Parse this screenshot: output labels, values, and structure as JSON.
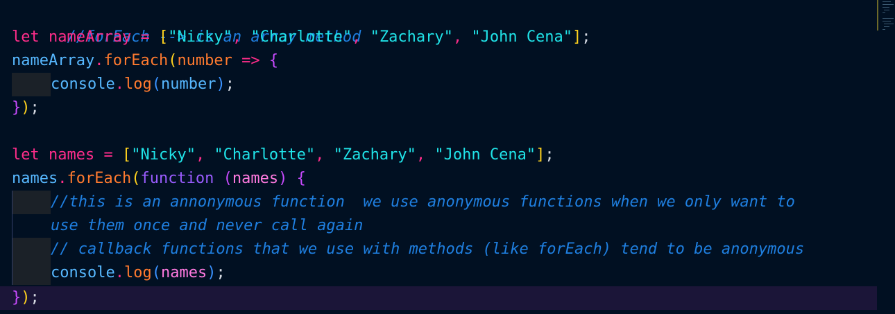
{
  "editor": {
    "lines": [
      {
        "text": "//forEach --> is an array method"
      },
      {
        "text": "let nameArray = [\"Nicky\", \"Charlotte\", \"Zachary\", \"John Cena\"];"
      },
      {
        "text": "nameArray.forEach(number => {"
      },
      {
        "text": "console.log(number);"
      },
      {
        "text": "});"
      },
      {
        "text": ""
      },
      {
        "text": "let names = [\"Nicky\", \"Charlotte\", \"Zachary\", \"John Cena\"];"
      },
      {
        "text": "names.forEach(function (names) {"
      },
      {
        "text": "//this is an annonymous function  we use anonymous functions when we only want to"
      },
      {
        "text": "use them once and never call again"
      },
      {
        "text": "// callback functions that we use with methods (like forEach) tend to be anonymous"
      },
      {
        "text": "console.log(names);"
      },
      {
        "text": "});"
      }
    ],
    "tokens": {
      "l1": {
        "t1": "//forEach --> is an array method"
      },
      "l2": {
        "t1": "let",
        "t2": " nameArray ",
        "t3": "=",
        "t4": " ",
        "t5": "[",
        "t6": "\"Nicky\"",
        "t7": ", ",
        "t8": "\"Charlotte\"",
        "t9": ", ",
        "t10": "\"Zachary\"",
        "t11": ", ",
        "t12": "\"John Cena\"",
        "t13": "]",
        "t14": ";"
      },
      "l3": {
        "t1": "nameArray",
        "t2": ".",
        "t3": "forEach",
        "t4": "(",
        "t5": "number",
        "t6": " ",
        "t7": "=>",
        "t8": " ",
        "t9": "{"
      },
      "l4": {
        "t1": "console",
        "t2": ".",
        "t3": "log",
        "t4": "(",
        "t5": "number",
        "t6": ")",
        "t7": ";"
      },
      "l5": {
        "t1": "}",
        "t2": ")",
        "t3": ";"
      },
      "l7": {
        "t1": "let",
        "t2": " names ",
        "t3": "=",
        "t4": " ",
        "t5": "[",
        "t6": "\"Nicky\"",
        "t7": ", ",
        "t8": "\"Charlotte\"",
        "t9": ", ",
        "t10": "\"Zachary\"",
        "t11": ", ",
        "t12": "\"John Cena\"",
        "t13": "]",
        "t14": ";"
      },
      "l8": {
        "t1": "names",
        "t2": ".",
        "t3": "forEach",
        "t4": "(",
        "t5": "function",
        "t6": " ",
        "t7": "(",
        "t8": "names",
        "t9": ")",
        "t10": " ",
        "t11": "{"
      },
      "l9": {
        "t1": "//this is an annonymous function  we use anonymous functions when we only want to"
      },
      "l10": {
        "t1": "use them once and never call again"
      },
      "l11": {
        "t1": "// callback functions that we use with methods (like forEach) tend to be anonymous"
      },
      "l12": {
        "t1": "console",
        "t2": ".",
        "t3": "log",
        "t4": "(",
        "t5": "names",
        "t6": ")",
        "t7": ";"
      },
      "l13": {
        "t1": "}",
        "t2": ")",
        "t3": ";"
      }
    },
    "colors": {
      "background": "#011022",
      "current_line": "#1b1538",
      "comment": "#1f7fe0",
      "keyword": "#ff2d8a",
      "variable": "#57b8ff",
      "method": "#ff7a2f",
      "string": "#20e3e8",
      "bracket_level1": "#ffd21e",
      "bracket_level2": "#c94bff",
      "bracket_level3": "#3a92ff",
      "parameter": "#ff7ae0"
    }
  }
}
